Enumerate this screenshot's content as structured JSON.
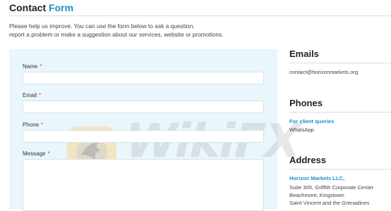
{
  "header": {
    "title_plain": "Contact",
    "title_accent": "Form"
  },
  "intro": {
    "line1": "Please help us improve. You can use the form below to ask a question,",
    "line2": "report a problem or make a suggestion about our services, website or promotions."
  },
  "form": {
    "name_label": "Name",
    "email_label": "Email",
    "phone_label": "Phone",
    "message_label": "Message",
    "required_marker": "*",
    "name_value": "",
    "email_value": "",
    "phone_value": "",
    "message_value": ""
  },
  "watermark": {
    "text": "WikiFX",
    "logo": "eagle-logo"
  },
  "sidebar": {
    "emails": {
      "heading": "Emails",
      "address": "contact@horizonmarkets.org"
    },
    "phones": {
      "heading": "Phones",
      "link": "For client queries",
      "value": "WhatsApp"
    },
    "address": {
      "heading": "Address",
      "company": "Horizon Markets LLC,",
      "lines": [
        "Suite 305, Griffith Corporate Center",
        "Beachmont, Kingstown",
        "Saint Vincent and the Grenadines"
      ]
    }
  },
  "colors": {
    "accent": "#1d8fc7",
    "required": "#e03a3a",
    "form_background": "#e9f6fc"
  }
}
